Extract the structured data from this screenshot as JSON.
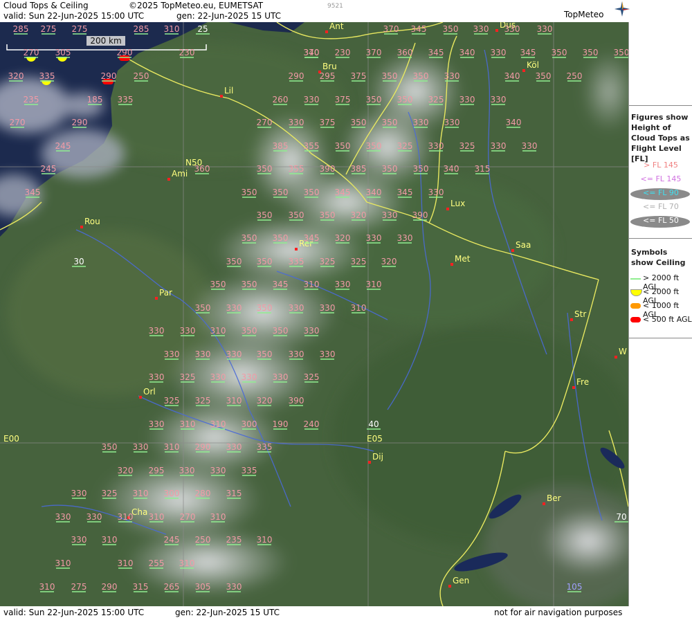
{
  "header": {
    "title": "Cloud Tops & Ceiling",
    "copyright": "©2025 TopMeteo.eu, EUMETSAT",
    "code": "9521",
    "valid": "valid:  Sun  22-Jun-2025  15:00 UTC",
    "gen": "gen:  22-Jun-2025  15 UTC",
    "logo": "TopMeteo"
  },
  "footer": {
    "valid": "valid:  Sun  22-Jun-2025  15:00 UTC",
    "gen": "gen:  22-Jun-2025  15 UTC",
    "note": "not for air navigation purposes"
  },
  "scale": "200 km",
  "legend": {
    "title": "Figures show Height of Cloud Tops as Flight Level  [FL]",
    "levels": [
      {
        "label": "> FL 145",
        "color": "#f08080",
        "oval": false
      },
      {
        "label": "<= FL 145",
        "color": "#d070e0",
        "oval": false
      },
      {
        "label": "<= FL 90",
        "color": "#40e0f0",
        "oval": true
      },
      {
        "label": "<= FL 70",
        "color": "#b8b8b8",
        "oval": false
      },
      {
        "label": "<= FL 50",
        "color": "#ffffff",
        "oval": true
      }
    ],
    "symbols_title": "Symbols show Ceiling",
    "symbols": [
      {
        "label": "> 2000 ft AGL",
        "color": "#90ee90",
        "shape": "line"
      },
      {
        "label": "< 2000 ft AGL",
        "color": "#ffff00",
        "shape": "half"
      },
      {
        "label": "< 1000 ft AGL",
        "color": "#ff9900",
        "shape": "pill"
      },
      {
        "label": "< 500 ft AGL",
        "color": "#ff0000",
        "shape": "pill"
      }
    ]
  },
  "grid_labels": [
    "N50",
    "E00",
    "E05"
  ],
  "cities": [
    "Ant",
    "Bru",
    "Dus",
    "Köl",
    "Lil",
    "Ami",
    "Rou",
    "Rer",
    "Lux",
    "Saa",
    "Met",
    "Par",
    "Str",
    "Orl",
    "Fre",
    "Dij",
    "Ber",
    "Cha",
    "Gen",
    "W"
  ],
  "values": {
    "pink": [
      "285",
      "275",
      "275",
      "285",
      "310",
      "270",
      "305",
      "290",
      "370",
      "230",
      "320",
      "335",
      "290",
      "250",
      "235",
      "185",
      "335",
      "270",
      "290",
      "245",
      "245",
      "345",
      "340",
      "230",
      "370",
      "360",
      "345",
      "340",
      "330",
      "345",
      "350",
      "350",
      "350",
      "370",
      "345",
      "350",
      "330",
      "330",
      "330",
      "340",
      "350",
      "250",
      "290",
      "295",
      "375",
      "350",
      "350",
      "330",
      "260",
      "330",
      "375",
      "350",
      "350",
      "325",
      "330",
      "330",
      "270",
      "330",
      "375",
      "350",
      "350",
      "330",
      "330",
      "340",
      "385",
      "355",
      "350",
      "350",
      "325",
      "330",
      "325",
      "330",
      "330",
      "350",
      "355",
      "390",
      "385",
      "350",
      "350",
      "340",
      "315",
      "360",
      "350",
      "350",
      "350",
      "345",
      "340",
      "345",
      "330",
      "350",
      "350",
      "350",
      "320",
      "330",
      "390",
      "350",
      "350",
      "345",
      "320",
      "330",
      "330",
      "350",
      "350",
      "335",
      "325",
      "325",
      "320",
      "350",
      "350",
      "345",
      "310",
      "330",
      "310",
      "350",
      "330",
      "350",
      "330",
      "330",
      "310",
      "330",
      "330",
      "310",
      "350",
      "350",
      "330",
      "330",
      "330",
      "330",
      "350",
      "330",
      "330",
      "330",
      "325",
      "330",
      "330",
      "330",
      "325",
      "325",
      "325",
      "310",
      "320",
      "390",
      "330",
      "310",
      "310",
      "300",
      "190",
      "240",
      "350",
      "330",
      "310",
      "290",
      "330",
      "335",
      "320",
      "295",
      "330",
      "330",
      "335",
      "330",
      "325",
      "310",
      "300",
      "280",
      "315",
      "330",
      "330",
      "310",
      "310",
      "270",
      "310",
      "330",
      "310",
      "245",
      "250",
      "235",
      "310",
      "310",
      "310",
      "255",
      "310",
      "310",
      "275",
      "290",
      "315",
      "265",
      "305",
      "330"
    ],
    "white": [
      "25",
      "30",
      "40",
      "70"
    ],
    "blue": [
      "105"
    ]
  }
}
